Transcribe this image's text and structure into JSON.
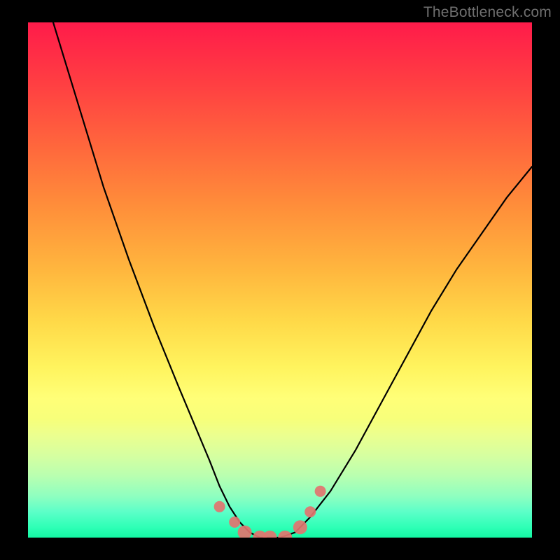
{
  "watermark": "TheBottleneck.com",
  "chart_data": {
    "type": "line",
    "title": "",
    "xlabel": "",
    "ylabel": "",
    "xlim": [
      0,
      100
    ],
    "ylim": [
      0,
      100
    ],
    "grid": false,
    "series": [
      {
        "name": "curve",
        "x": [
          5,
          10,
          15,
          20,
          25,
          30,
          33,
          36,
          38,
          40,
          42,
          44,
          46,
          48,
          50,
          53,
          56,
          60,
          65,
          70,
          75,
          80,
          85,
          90,
          95,
          100
        ],
        "y": [
          100,
          84,
          68,
          54,
          41,
          29,
          22,
          15,
          10,
          6,
          3,
          1,
          0,
          0,
          0,
          1,
          4,
          9,
          17,
          26,
          35,
          44,
          52,
          59,
          66,
          72
        ]
      }
    ],
    "markers": {
      "name": "points",
      "x": [
        38,
        41,
        43,
        46,
        48,
        51,
        54,
        56,
        58
      ],
      "y": [
        6,
        3,
        1,
        0,
        0,
        0,
        2,
        5,
        9
      ]
    },
    "colors": {
      "curve": "#000000",
      "markers": "#e2746f",
      "gradient_top": "#ff1b4a",
      "gradient_bottom": "#13f7a3"
    }
  }
}
